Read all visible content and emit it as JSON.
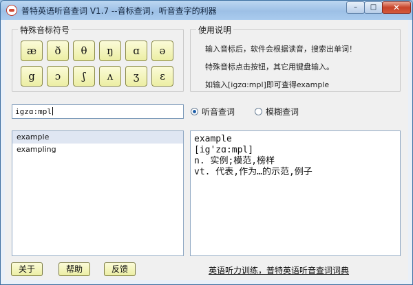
{
  "window": {
    "title": "普特英语听音查词 V1.7 --音标查词，听音查字的利器",
    "controls": {
      "minimize": "–",
      "maximize": "□",
      "close": "✕"
    }
  },
  "phonetics": {
    "group_label": "特殊音标符号",
    "row1": [
      "æ",
      "ð",
      "θ",
      "ŋ",
      "ɑ",
      "ə"
    ],
    "row2": [
      "g",
      "ɔ",
      "ʃ",
      "ʌ",
      "ʒ",
      "ɛ"
    ]
  },
  "help": {
    "group_label": "使用说明",
    "lines": [
      "输入音标后，软件会根据读音，搜索出单词！",
      "特殊音标点击按钮，其它用键盘输入。",
      "如输入[igzɑ:mpl]即可查得example"
    ]
  },
  "search": {
    "value": "igzɑ:mpl"
  },
  "mode": {
    "listen_label": "听音查词",
    "fuzzy_label": "模糊查词",
    "selected": "听音查词"
  },
  "results": [
    {
      "word": "example",
      "selected": true
    },
    {
      "word": "exampling",
      "selected": false
    }
  ],
  "detail": {
    "lines": [
      "example",
      "[ig'zɑ:mpl]",
      "n. 实例;模范,榜样",
      "vt. 代表,作为…的示范,例子"
    ]
  },
  "buttons": {
    "about": "关于",
    "help": "帮助",
    "feedback": "反馈"
  },
  "footer": {
    "link": "英语听力训练，普特英语听音查词词典"
  },
  "colors": {
    "button_face": "#eceea4",
    "titlebar": "#9dc0e6",
    "close_button": "#c7432a",
    "selection": "#dfe6f2"
  }
}
